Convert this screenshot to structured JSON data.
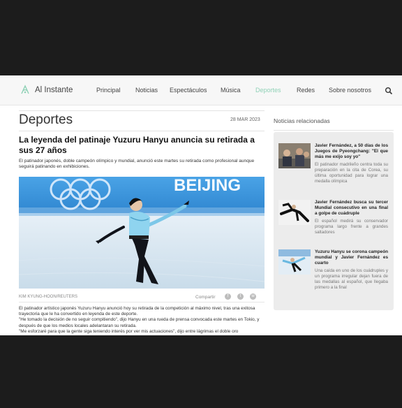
{
  "header": {
    "logo_text": "Al Instante",
    "nav": [
      "Principal",
      "Noticias",
      "Espectáculos",
      "Música",
      "Deportes",
      "Redes",
      "Sobre nosotros"
    ],
    "active_nav": "Deportes",
    "accent_color": "#8fd1b6"
  },
  "article": {
    "section": "Deportes",
    "date": "28 MAR 2023",
    "headline": "La leyenda del patinaje Yuzuru Hanyu anuncia su retirada a sus 27 años",
    "lead": "El patinador japonés, doble campeón olímpico y mundial, anunció este martes su retirada como profesional aunque seguirá patinando en exhibiciones.",
    "photo_banner_text": "BEIJING",
    "credit": "KIM KYUNG-HOON/REUTERS",
    "share_label": "Compartir",
    "share_icons": [
      "facebook-icon",
      "twitter-icon",
      "whatsapp-icon"
    ],
    "body": [
      "El patinador artístico japonés Yuzuru Hanyu anunció hoy su retirada de la competición al máximo nivel, tras una exitosa trayectoria que le ha convertido en leyenda de este deporte.",
      "\"He tomado la decisión de no seguir compitiendo\", dijo Hanyu en una rueda de prensa convocada este martes en Tokio, y después de que los medios locales adelantaran su retirada.",
      "\"Me esforzaré para que la gente siga teniendo interés por ver mis actuaciones\", dijo entre lágrimas el doble oro"
    ]
  },
  "sidebar": {
    "title": "Noticias relacionadas",
    "items": [
      {
        "title": "Javier Fernández, a 50 días de los Juegos de Pyeongchang: \"El que más me exijo soy yo\"",
        "desc": "El patinador madrileño centra toda su preparación en la cita de Corea, su última oportunidad para lograr una medalla olímpica"
      },
      {
        "title": "Javier Fernández busca su tercer Mundial consecutivo en una final a golpe de cuádruple",
        "desc": "El español medirá su conservador programa largo frente a grandes saltadores"
      },
      {
        "title": "Yuzuru Hanyu se corona campeón mundial y Javier Fernández es cuarto",
        "desc": "Una caída en uno de los cuádruples y un programa irregular dejan fuera de las medallas al español, que llegaba primero a la final"
      }
    ]
  }
}
